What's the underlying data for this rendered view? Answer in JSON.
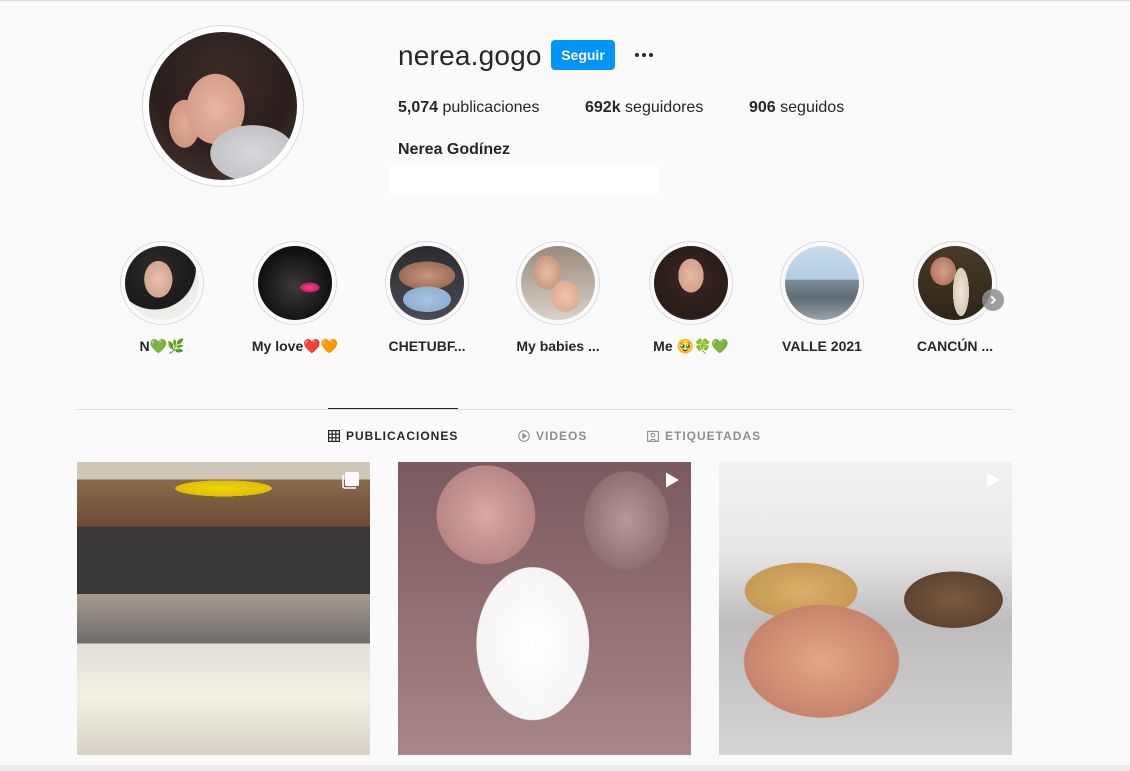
{
  "profile": {
    "username": "nerea.gogo",
    "follow_label": "Seguir",
    "posts_count": "5,074",
    "posts_label": "publicaciones",
    "followers_count": "692k",
    "followers_label": "seguidores",
    "following_count": "906",
    "following_label": "seguidos",
    "full_name": "Nerea Godínez"
  },
  "highlights": [
    {
      "label": "N💚🌿"
    },
    {
      "label": "My love❤️🧡"
    },
    {
      "label": "CHETUBF..."
    },
    {
      "label": "My babies ..."
    },
    {
      "label": "Me 🥹🍀💚"
    },
    {
      "label": "VALLE 2021"
    },
    {
      "label": "CANCÚN ..."
    }
  ],
  "tabs": [
    {
      "label": "PUBLICACIONES",
      "active": true,
      "icon": "grid-icon"
    },
    {
      "label": "VIDEOS",
      "active": false,
      "icon": "play-circle-icon"
    },
    {
      "label": "ETIQUETADAS",
      "active": false,
      "icon": "tag-icon"
    }
  ],
  "posts": [
    {
      "type": "carousel",
      "icon": "carousel-icon"
    },
    {
      "type": "video",
      "icon": "video-icon"
    },
    {
      "type": "video",
      "icon": "video-icon"
    }
  ],
  "colors": {
    "accent": "#0095f6",
    "text": "#262626",
    "muted": "#8e8e8e",
    "border": "#dbdbdb",
    "background": "#fafafa"
  }
}
